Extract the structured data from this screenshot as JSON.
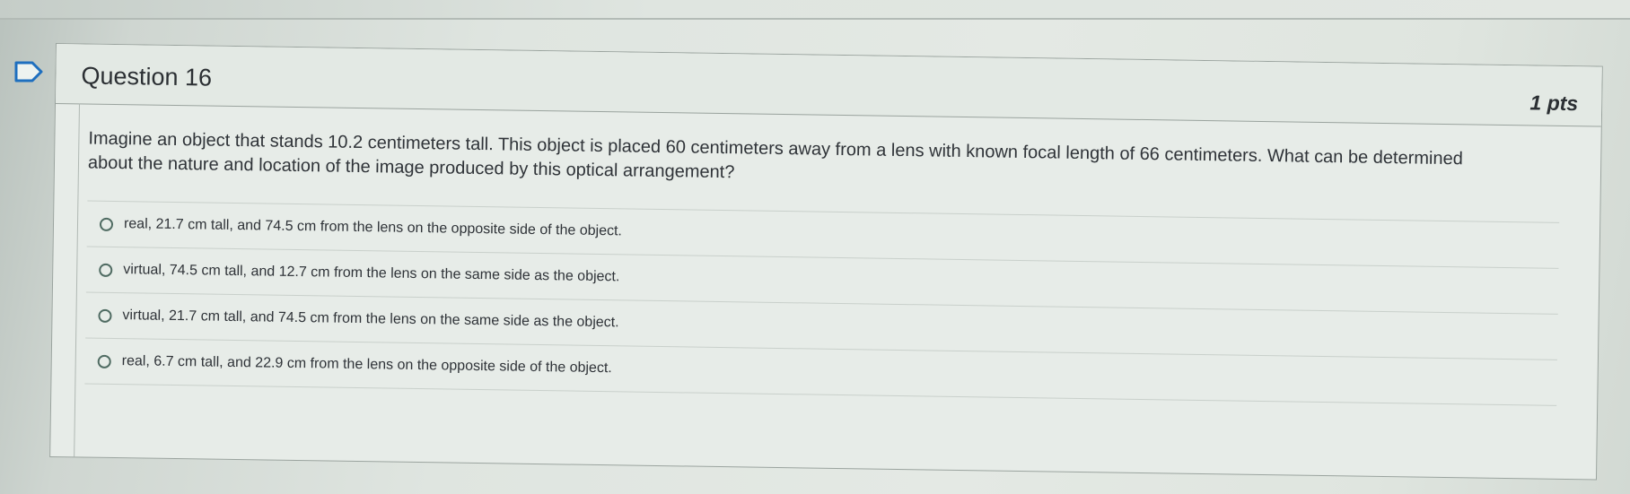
{
  "question": {
    "title": "Question 16",
    "points": "1 pts",
    "text": "Imagine an object that stands 10.2 centimeters tall. This object is placed 60 centimeters away from a lens with known focal length of 66 centimeters. What can be determined about the nature and location of the image produced by this optical arrangement?",
    "answers": [
      {
        "label": "real, 21.7 cm tall, and 74.5 cm from the lens on the opposite side of the object."
      },
      {
        "label": "virtual, 74.5 cm tall, and 12.7 cm from the lens on the same side as the object."
      },
      {
        "label": "virtual, 21.7 cm tall, and 74.5 cm from the lens on the same side as the object."
      },
      {
        "label": "real, 6.7 cm tall, and 22.9 cm from the lens on the opposite side of the object."
      }
    ]
  },
  "icons": {
    "flag": "flag-icon",
    "radio": "radio-unselected-icon"
  },
  "colors": {
    "accent": "#1e6fbf",
    "border": "#9aa39e",
    "text": "#2f3338"
  }
}
